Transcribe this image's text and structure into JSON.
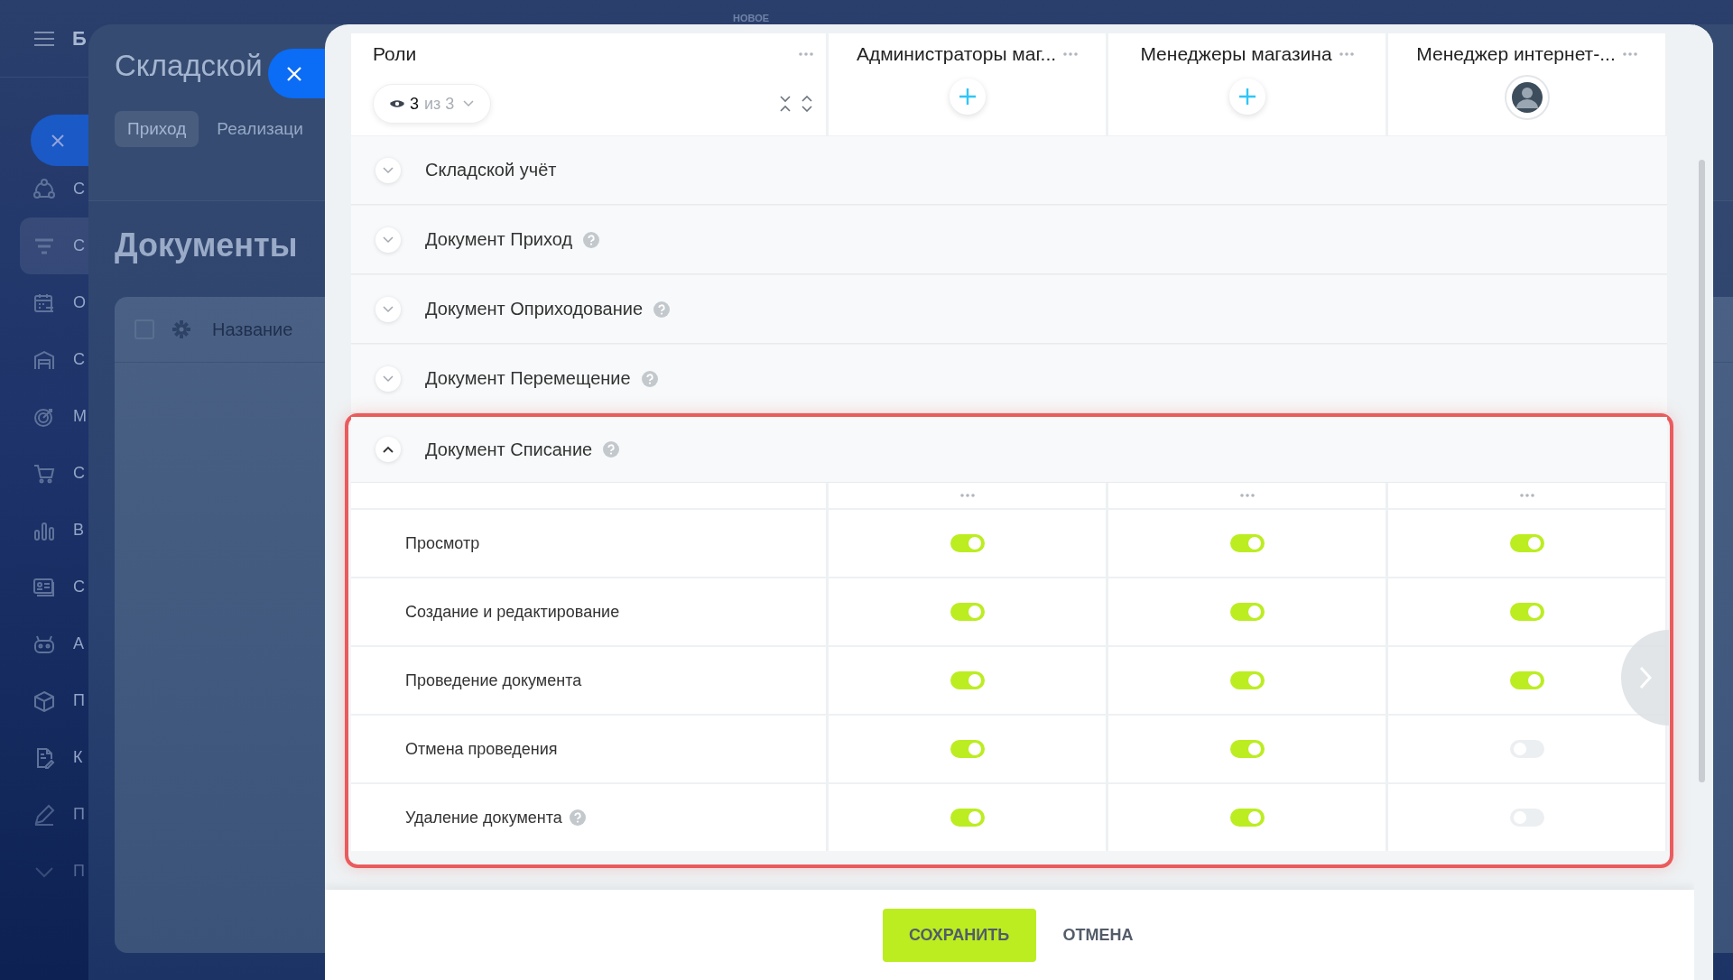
{
  "sidebar": {
    "app_initial": "Б",
    "items": [
      {
        "label": "С",
        "selected": false
      },
      {
        "label": "С",
        "selected": true
      },
      {
        "label": "О",
        "selected": false
      },
      {
        "label": "С",
        "selected": false
      },
      {
        "label": "М",
        "selected": false
      },
      {
        "label": "С",
        "selected": false
      },
      {
        "label": "В",
        "selected": false
      },
      {
        "label": "С",
        "selected": false
      },
      {
        "label": "А",
        "selected": false
      },
      {
        "label": "П",
        "selected": false
      },
      {
        "label": "К",
        "selected": false
      },
      {
        "label": "П",
        "selected": false
      },
      {
        "label": "П",
        "selected": false
      }
    ]
  },
  "background_panel": {
    "title": "Складской",
    "tabs": [
      {
        "label": "Приход",
        "selected": true
      },
      {
        "label": "Реализаци",
        "selected": false
      }
    ],
    "heading": "Документы",
    "table": {
      "select_all_checked": false,
      "columns": [
        "Название"
      ]
    }
  },
  "badge": "НОВОЕ",
  "roles_header": {
    "title": "Роли",
    "filter": {
      "count": "3",
      "total": "из 3"
    }
  },
  "roles": [
    {
      "name": "Администраторы маг...",
      "kind": "add"
    },
    {
      "name": "Менеджеры магазина",
      "kind": "add"
    },
    {
      "name": "Менеджер интернет-...",
      "kind": "avatar"
    }
  ],
  "sections": [
    {
      "title": "Складской учёт",
      "help": false,
      "expanded": false
    },
    {
      "title": "Документ Приход",
      "help": true,
      "expanded": false
    },
    {
      "title": "Документ Оприходование",
      "help": true,
      "expanded": false
    },
    {
      "title": "Документ Перемещение",
      "help": true,
      "expanded": false
    },
    {
      "title": "Документ Списание",
      "help": true,
      "expanded": true,
      "permissions": [
        {
          "label": "Просмотр",
          "help": false,
          "toggles": [
            {
              "on": true
            },
            {
              "on": true
            },
            {
              "on": true
            }
          ]
        },
        {
          "label": "Создание и редактирование",
          "help": false,
          "toggles": [
            {
              "on": true
            },
            {
              "on": true
            },
            {
              "on": true
            }
          ]
        },
        {
          "label": "Проведение документа",
          "help": false,
          "toggles": [
            {
              "on": true
            },
            {
              "on": true
            },
            {
              "on": true
            }
          ]
        },
        {
          "label": "Отмена проведения",
          "help": false,
          "toggles": [
            {
              "on": true
            },
            {
              "on": true
            },
            {
              "on": false
            }
          ]
        },
        {
          "label": "Удаление документа",
          "help": true,
          "toggles": [
            {
              "on": true
            },
            {
              "on": true
            },
            {
              "on": false
            }
          ]
        }
      ]
    }
  ],
  "footer": {
    "buttons": [
      {
        "label": "СОХРАНИТЬ",
        "kind": "primary"
      },
      {
        "label": "ОТМЕНА",
        "kind": "link"
      }
    ]
  }
}
